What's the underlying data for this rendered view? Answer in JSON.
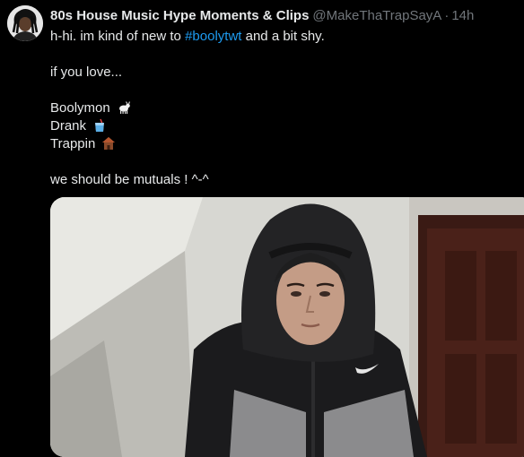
{
  "tweet": {
    "display_name": "80s House Music Hype Moments & Clips",
    "handle": "@MakeThaTrapSayA",
    "separator": "·",
    "timestamp": "14h",
    "text": {
      "line1_before": "h-hi. im kind of new to ",
      "hashtag": "#boolytwt",
      "line1_after": " and a bit shy.",
      "line2": "if you love...",
      "item1": "Boolymon",
      "item1_icon": "goat-icon",
      "item2": "Drank",
      "item2_icon": "cup-with-straw-icon",
      "item3": "Trappin",
      "item3_icon": "house-icon",
      "line_last": "we should be mutuals ! ^-^"
    },
    "media": {
      "description_icon": "photo-of-person-in-black-hoodie"
    }
  },
  "colors": {
    "background": "#000000",
    "text_primary": "#e7e9ea",
    "text_secondary": "#71767b",
    "link": "#1d9bf0"
  }
}
